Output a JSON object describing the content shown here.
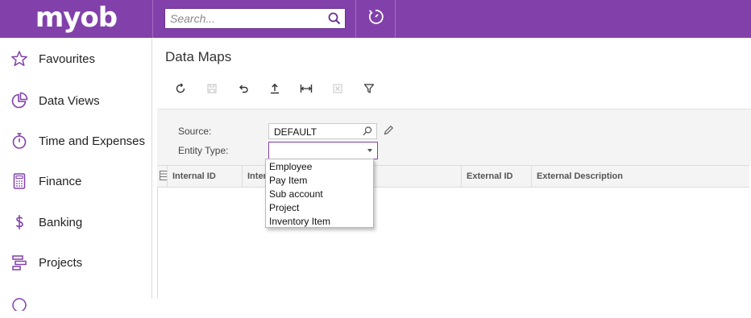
{
  "app": {
    "logo": "myob",
    "search_placeholder": "Search..."
  },
  "sidebar": {
    "items": [
      {
        "label": "Favourites",
        "icon": "star-icon"
      },
      {
        "label": "Data Views",
        "icon": "pie-chart-icon"
      },
      {
        "label": "Time and Expenses",
        "icon": "stopwatch-icon"
      },
      {
        "label": "Finance",
        "icon": "calculator-icon"
      },
      {
        "label": "Banking",
        "icon": "dollar-icon"
      },
      {
        "label": "Projects",
        "icon": "projects-icon"
      }
    ]
  },
  "page": {
    "title": "Data Maps"
  },
  "toolbar": {
    "buttons": [
      "refresh-icon",
      "save-icon",
      "undo-icon",
      "upload-icon",
      "fit-columns-icon",
      "excel-export-icon",
      "filter-icon"
    ]
  },
  "form": {
    "source_label": "Source:",
    "source_value": "DEFAULT",
    "entity_type_label": "Entity Type:",
    "entity_type_value": ""
  },
  "grid": {
    "columns": [
      "Internal ID",
      "Internal Description",
      "External ID",
      "External Description"
    ]
  },
  "dropdown": {
    "options": [
      "Employee",
      "Pay Item",
      "Sub account",
      "Project",
      "Inventory Item"
    ]
  }
}
